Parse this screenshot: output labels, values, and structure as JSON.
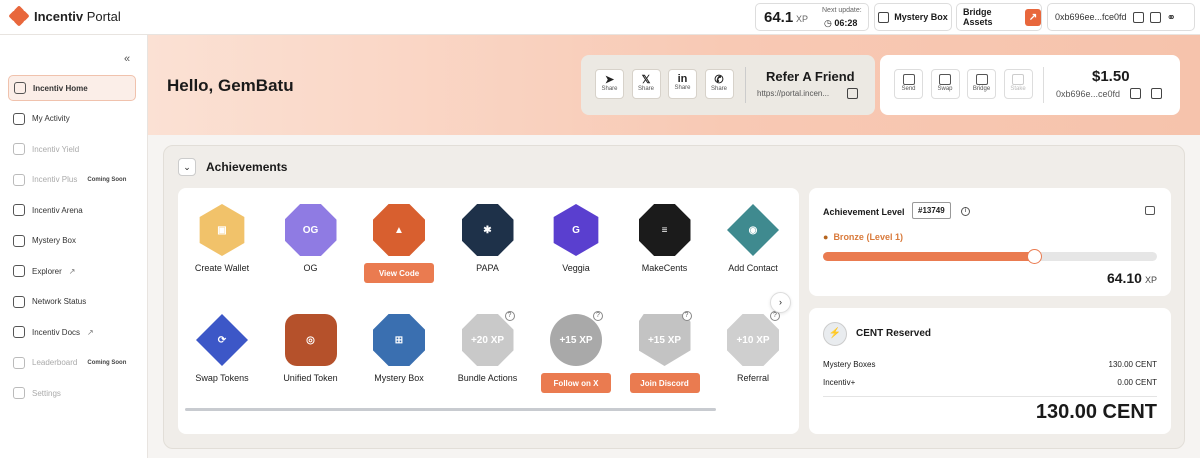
{
  "header": {
    "logo_brand": "Incentiv",
    "logo_product": "Portal",
    "xp_value": "64.1",
    "xp_unit": "XP",
    "next_update_label": "Next update:",
    "next_update_time": "06:28",
    "mystery_box_label": "Mystery Box",
    "bridge_label": "Bridge Assets",
    "wallet_address": "0xb696ee...fce0fd"
  },
  "sidebar": {
    "collapse_icon": "chevrons-left-icon",
    "items": [
      {
        "label": "Incentiv Home",
        "icon": "home-icon",
        "state": "active"
      },
      {
        "label": "My Activity",
        "icon": "activity-icon"
      },
      {
        "label": "Incentiv Yield",
        "icon": "yield-icon",
        "state": "disabled"
      },
      {
        "label": "Incentiv Plus",
        "icon": "plus-circle-icon",
        "state": "disabled",
        "badge": "Coming Soon"
      },
      {
        "label": "Incentiv Arena",
        "icon": "arena-icon"
      },
      {
        "label": "Mystery Box",
        "icon": "gift-icon"
      },
      {
        "label": "Explorer",
        "icon": "eye-icon",
        "external": "↗"
      },
      {
        "label": "Network Status",
        "icon": "cube-icon"
      },
      {
        "label": "Incentiv Docs",
        "icon": "docs-icon",
        "external": "↗"
      },
      {
        "label": "Leaderboard",
        "icon": "trophy-icon",
        "state": "disabled",
        "badge": "Coming Soon"
      },
      {
        "label": "Settings",
        "icon": "user-icon",
        "state": "disabled"
      }
    ]
  },
  "hero": {
    "greeting": "Hello, GemBatu",
    "refer": {
      "title": "Refer A Friend",
      "link": "https://portal.incen...",
      "share_buttons": [
        {
          "glyph": "➤",
          "label": "Share",
          "icon": "telegram-icon"
        },
        {
          "glyph": "𝕏",
          "label": "Share",
          "icon": "x-icon"
        },
        {
          "glyph": "in",
          "label": "Share",
          "icon": "linkedin-icon"
        },
        {
          "glyph": "✆",
          "label": "Share",
          "icon": "whatsapp-icon"
        }
      ]
    },
    "wallet": {
      "balance": "$1.50",
      "address": "0xb696e...ce0fd",
      "actions": [
        {
          "label": "Send",
          "icon": "send-icon",
          "enabled": true
        },
        {
          "label": "Swap",
          "icon": "swap-icon",
          "enabled": true
        },
        {
          "label": "Bridge",
          "icon": "bridge-icon",
          "enabled": true
        },
        {
          "label": "Stake",
          "icon": "stake-icon",
          "enabled": false
        }
      ]
    }
  },
  "achievements": {
    "title": "Achievements",
    "toggle_icon": "chevron-down-icon",
    "next_icon": "chevron-right-icon",
    "badges": [
      {
        "label": "Create Wallet",
        "shape": "hex",
        "color": "#f1c26a",
        "glyph": "▣"
      },
      {
        "label": "OG",
        "shape": "oct",
        "color": "#8f7be3",
        "glyph": "OG"
      },
      {
        "label": "",
        "shape": "oct",
        "color": "#d85f2f",
        "glyph": "▲",
        "button": "View Code"
      },
      {
        "label": "PAPA",
        "shape": "oct",
        "color": "#1e3149",
        "glyph": "✱"
      },
      {
        "label": "Veggia",
        "shape": "hex",
        "color": "#5a3fcf",
        "glyph": "G"
      },
      {
        "label": "MakeCents",
        "shape": "oct",
        "color": "#1b1b1b",
        "glyph": "≡"
      },
      {
        "label": "Add Contact",
        "shape": "diam",
        "color": "#3f8a8f",
        "glyph": "◉"
      },
      {
        "label": "Swap Tokens",
        "shape": "diam",
        "color": "#3c57c7",
        "glyph": "⟳"
      },
      {
        "label": "Unified Token",
        "shape": "rsq",
        "color": "#b5512b",
        "glyph": "◎"
      },
      {
        "label": "Mystery Box",
        "shape": "oct",
        "color": "#3a6fb0",
        "glyph": "⊞"
      },
      {
        "label": "Bundle Actions",
        "shape": "oct",
        "color": "#c9c9c9",
        "glyph": "+20 XP",
        "help": "?"
      },
      {
        "label": "",
        "shape": "circ",
        "color": "#a9a9a9",
        "glyph": "+15 XP",
        "help": "?",
        "button": "Follow on X"
      },
      {
        "label": "",
        "shape": "shield",
        "color": "#c3c3c3",
        "glyph": "+15 XP",
        "help": "?",
        "button": "Join Discord"
      },
      {
        "label": "Referral",
        "shape": "oct",
        "color": "#cfcfcf",
        "glyph": "+10 XP",
        "help": "?"
      }
    ]
  },
  "level": {
    "title": "Achievement Level",
    "rank_id": "#13749",
    "info_icon": "i",
    "rank_name": "Bronze (Level 1)",
    "progress": 0.64,
    "xp_value": "64.10",
    "xp_unit": "XP"
  },
  "cent": {
    "logo_glyph": "⚡",
    "title": "CENT Reserved",
    "rows": [
      {
        "label": "Mystery Boxes",
        "value": "130.00 CENT"
      },
      {
        "label": "Incentiv+",
        "value": "0.00 CENT"
      }
    ],
    "total": "130.00 CENT"
  }
}
